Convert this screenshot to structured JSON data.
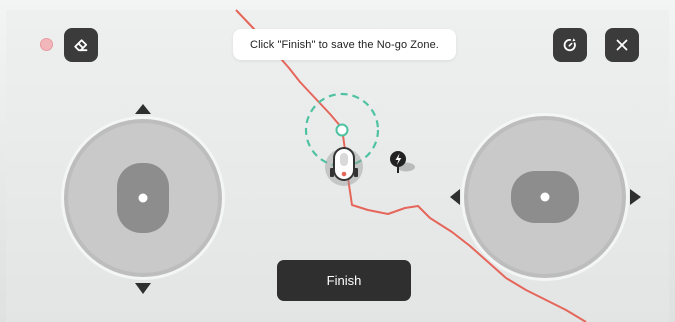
{
  "toast": {
    "message": "Click \"Finish\" to save the No-go Zone."
  },
  "toolbar": {
    "recording_indicator_color": "#f2b7bb",
    "eraser_icon": "eraser-icon",
    "rotate_icon": "rotate-icon",
    "close_icon": "close-icon"
  },
  "finish_button": {
    "label": "Finish"
  },
  "map": {
    "boundary_color": "#e5665a",
    "zone_circle_color": "#4fc3a1",
    "charging_icon": "charging-station-icon",
    "robot_icon": "mower-robot-icon"
  },
  "joysticks": {
    "left": {
      "directions": [
        "up",
        "down"
      ]
    },
    "right": {
      "directions": [
        "left",
        "right"
      ]
    }
  }
}
